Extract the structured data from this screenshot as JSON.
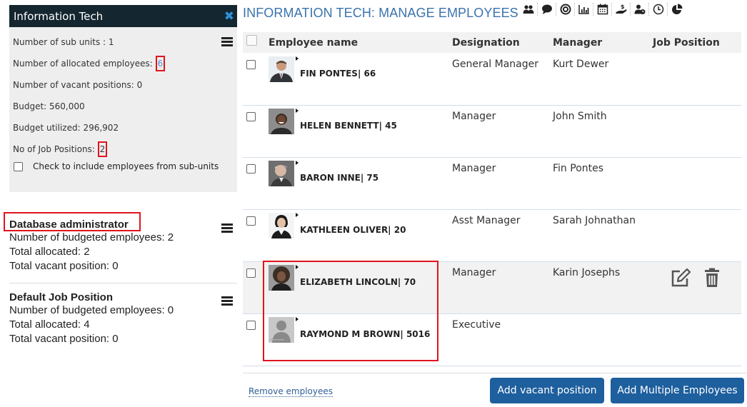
{
  "unit_panel": {
    "title": "Information Tech",
    "rows": [
      {
        "label": "Number of sub units : ",
        "value": "1"
      },
      {
        "label": "Number of allocated employees: ",
        "value": "6"
      },
      {
        "label": "Number of vacant positions: ",
        "value": "0"
      },
      {
        "label": "Budget: ",
        "value": "560,000"
      },
      {
        "label": "Budget utilized: ",
        "value": "296,902"
      },
      {
        "label": "No of Job Positions: ",
        "value": "2"
      }
    ],
    "include_subunits_label": "Check to include employees from sub-units"
  },
  "job_positions": [
    {
      "title": "Database administrator",
      "lines": [
        "Number of budgeted employees: 2",
        "Total allocated: 2",
        "Total vacant position: 0"
      ]
    },
    {
      "title": "Default Job Position",
      "lines": [
        "Number of budgeted employees: 0",
        "Total allocated: 4",
        "Total vacant position: 0"
      ]
    }
  ],
  "page_title": "INFORMATION TECH: MANAGE EMPLOYEES",
  "toolbar_icons": [
    "people-icon",
    "chat-icon",
    "target-icon",
    "bar-chart-icon",
    "calendar-icon",
    "payment-icon",
    "user-clock-icon",
    "clock-icon",
    "pie-chart-icon"
  ],
  "table": {
    "columns": [
      "Employee name",
      "Designation",
      "Manager",
      "Job Position"
    ],
    "rows": [
      {
        "name": "FIN PONTES| 66",
        "designation": "General Manager",
        "manager": "Kurt Dewer",
        "job_position": "",
        "avatar": "man-suit"
      },
      {
        "name": "HELEN BENNETT| 45",
        "designation": "Manager",
        "manager": "John Smith",
        "job_position": "",
        "avatar": "woman-smile"
      },
      {
        "name": "BARON INNE| 75",
        "designation": "Manager",
        "manager": "Fin Pontes",
        "job_position": "",
        "avatar": "man-grey"
      },
      {
        "name": "KATHLEEN OLIVER| 20",
        "designation": "Asst Manager",
        "manager": "Sarah Johnathan",
        "job_position": "",
        "avatar": "woman-office"
      },
      {
        "name": "ELIZABETH LINCOLN| 70",
        "designation": "Manager",
        "manager": "Karin Josephs",
        "job_position": "",
        "avatar": "woman-curly"
      },
      {
        "name": "RAYMOND M BROWN| 5016",
        "designation": "Executive",
        "manager": "",
        "job_position": "",
        "avatar": "no-photo"
      }
    ]
  },
  "footer": {
    "remove_link": "Remove employees",
    "add_vacant": "Add vacant position",
    "add_multiple": "Add Multiple Employees"
  },
  "colors": {
    "header_bg": "#14262f",
    "accent": "#3a73ad",
    "button": "#1e5f9e",
    "highlight": "#e0141e"
  }
}
